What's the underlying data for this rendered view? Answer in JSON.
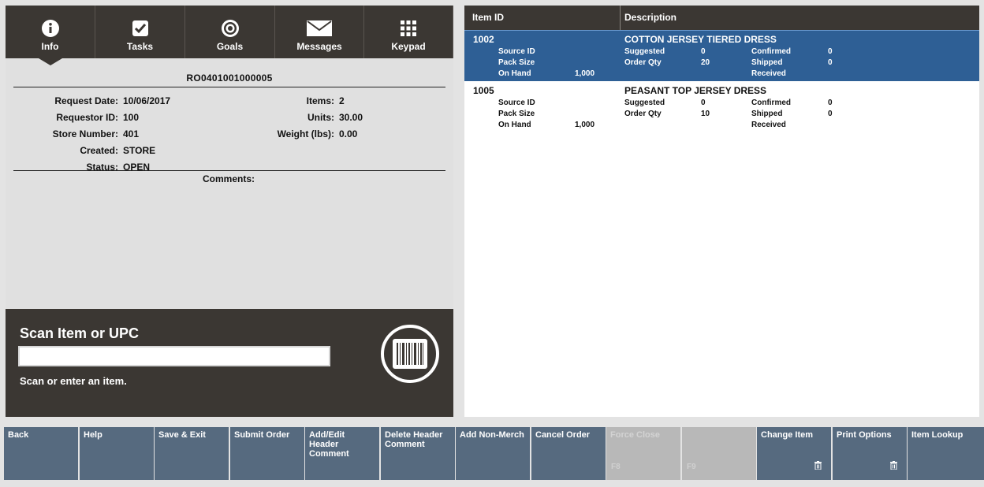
{
  "tabs": [
    {
      "label": "Info",
      "icon": "info-icon"
    },
    {
      "label": "Tasks",
      "icon": "tasks-check-icon"
    },
    {
      "label": "Goals",
      "icon": "goals-target-icon"
    },
    {
      "label": "Messages",
      "icon": "envelope-icon"
    },
    {
      "label": "Keypad",
      "icon": "keypad-grid-icon"
    }
  ],
  "request": {
    "code": "RO0401001000005",
    "request_date_label": "Request Date:",
    "request_date": "10/06/2017",
    "requestor_label": "Requestor ID:",
    "requestor": "100",
    "store_label": "Store Number:",
    "store": "401",
    "created_label": "Created:",
    "created": "STORE",
    "status_label": "Status:",
    "status": "OPEN",
    "items_label": "Items:",
    "items": "2",
    "units_label": "Units:",
    "units": "30.00",
    "weight_label": "Weight (lbs):",
    "weight": "0.00",
    "comments_label": "Comments:"
  },
  "scan": {
    "title": "Scan Item or UPC",
    "placeholder": "",
    "hint": "Scan or enter an item.",
    "button_icon": "barcode-icon"
  },
  "table": {
    "col_item_id": "Item ID",
    "col_description": "Description",
    "rows": [
      {
        "item_id": "1002",
        "description": "COTTON JERSEY TIERED DRESS",
        "source_id_label": "Source ID",
        "source_id": "",
        "pack_size_label": "Pack Size",
        "pack_size": "",
        "on_hand_label": "On Hand",
        "on_hand": "1,000",
        "suggested_label": "Suggested",
        "suggested": "0",
        "order_qty_label": "Order Qty",
        "order_qty": "20",
        "confirmed_label": "Confirmed",
        "confirmed": "0",
        "shipped_label": "Shipped",
        "shipped": "0",
        "received_label": "Received",
        "received": ""
      },
      {
        "item_id": "1005",
        "description": "PEASANT TOP JERSEY DRESS",
        "source_id_label": "Source ID",
        "source_id": "",
        "pack_size_label": "Pack Size",
        "pack_size": "",
        "on_hand_label": "On Hand",
        "on_hand": "1,000",
        "suggested_label": "Suggested",
        "suggested": "0",
        "order_qty_label": "Order Qty",
        "order_qty": "10",
        "confirmed_label": "Confirmed",
        "confirmed": "0",
        "shipped_label": "Shipped",
        "shipped": "0",
        "received_label": "Received",
        "received": ""
      }
    ]
  },
  "buttons": [
    {
      "label": "Back"
    },
    {
      "label": "Help"
    },
    {
      "label": "Save & Exit"
    },
    {
      "label": "Submit Order"
    },
    {
      "label": "Add/Edit Header Comment"
    },
    {
      "label": "Delete Header Comment"
    },
    {
      "label": "Add Non-Merch"
    },
    {
      "label": "Cancel Order"
    },
    {
      "label": "Force Close",
      "key": "F8",
      "disabled": true
    },
    {
      "label": "",
      "key": "F9",
      "disabled": true
    },
    {
      "label": "Change Item",
      "icon": "trash-icon"
    },
    {
      "label": "Print Options",
      "icon": "trash-icon"
    },
    {
      "label": "Item Lookup"
    }
  ],
  "colors": {
    "dark": "#3b3733",
    "selected_row": "#2e5f95",
    "button": "#566a7f",
    "button_disabled": "#b8b8b8"
  }
}
